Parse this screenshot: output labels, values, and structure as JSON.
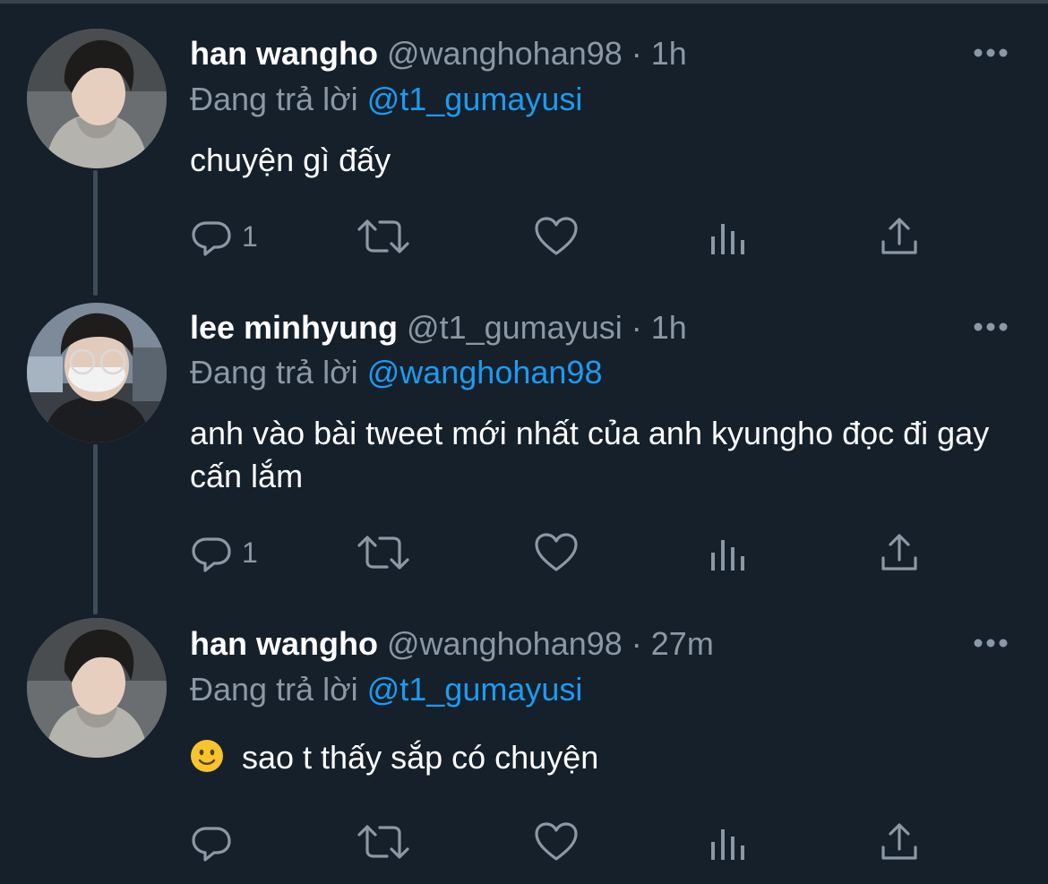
{
  "tweets": [
    {
      "name": "han wangho",
      "handle": "@wanghohan98",
      "time": "· 1h",
      "reply_prefix": "Đang trả lời",
      "reply_to": "@t1_gumayusi",
      "text": "chuyện gì đấy",
      "reply_count": "1",
      "avatar_icon": "avatar-photo"
    },
    {
      "name": "lee minhyung",
      "handle": "@t1_gumayusi",
      "time": "· 1h",
      "reply_prefix": "Đang trả lời",
      "reply_to": "@wanghohan98",
      "text": "anh vào bài tweet mới nhất của anh kyungho đọc đi gay cấn lắm",
      "reply_count": "1",
      "avatar_icon": "avatar-photo"
    },
    {
      "name": "han wangho",
      "handle": "@wanghohan98",
      "time": "· 27m",
      "reply_prefix": "Đang trả lời",
      "reply_to": "@t1_gumayusi",
      "emoji": "slightly-smiling-face-icon",
      "text": "sao t thấy sắp có chuyện",
      "reply_count": "",
      "avatar_icon": "avatar-photo"
    }
  ],
  "icons": [
    "reply-icon",
    "retweet-icon",
    "like-icon",
    "analytics-icon",
    "share-icon",
    "more-icon"
  ],
  "colors": {
    "background": "#15202b",
    "text": "#ffffff",
    "secondary": "#8b98a5",
    "link": "#1d9bf0",
    "thread_line": "#3d4c59"
  }
}
